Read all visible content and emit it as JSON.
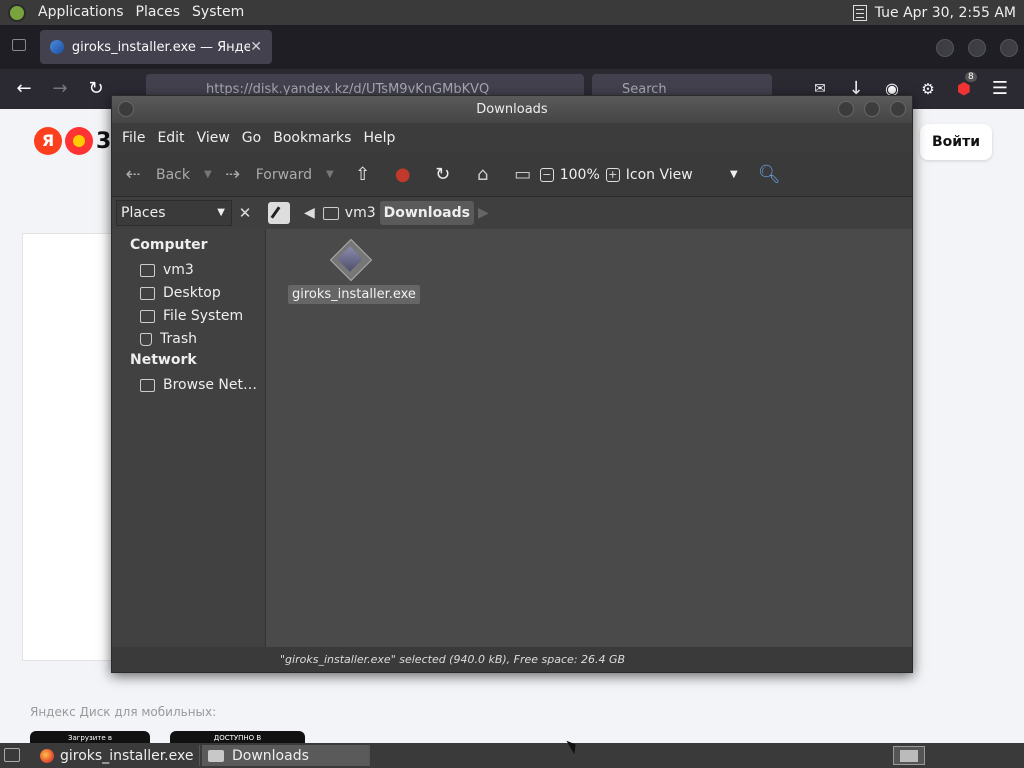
{
  "top_panel": {
    "menus": [
      "Applications",
      "Places",
      "System"
    ],
    "clock": "Tue Apr 30,  2:55 AM"
  },
  "browser": {
    "tab_title": "giroks_installer.exe — Янде",
    "url": "https://disk.yandex.kz/d/UTsM9vKnGMbKVQ",
    "search_placeholder": "Search",
    "extension_badge": "8",
    "page": {
      "login_button": "Войти",
      "mobile_text": "Яндекс Диск для мобильных:",
      "store_badge_1": "Загрузите в",
      "store_badge_2": "ДОСТУПНО В"
    }
  },
  "file_manager": {
    "title": "Downloads",
    "menu": [
      "File",
      "Edit",
      "View",
      "Go",
      "Bookmarks",
      "Help"
    ],
    "toolbar": {
      "back": "Back",
      "forward": "Forward",
      "zoom": "100%",
      "view_mode": "Icon View"
    },
    "sidebar_selector": "Places",
    "path": [
      "vm3",
      "Downloads"
    ],
    "sidebar": {
      "computer_heading": "Computer",
      "computer_items": [
        "vm3",
        "Desktop",
        "File System",
        "Trash"
      ],
      "network_heading": "Network",
      "network_items": [
        "Browse Net…"
      ]
    },
    "files": [
      {
        "name": "giroks_installer.exe",
        "icon": "executable-icon"
      }
    ],
    "status": "\"giroks_installer.exe\" selected (940.0 kB), Free space: 26.4 GB"
  },
  "taskbar": {
    "tasks": [
      "giroks_installer.exe ...",
      "Downloads"
    ]
  }
}
